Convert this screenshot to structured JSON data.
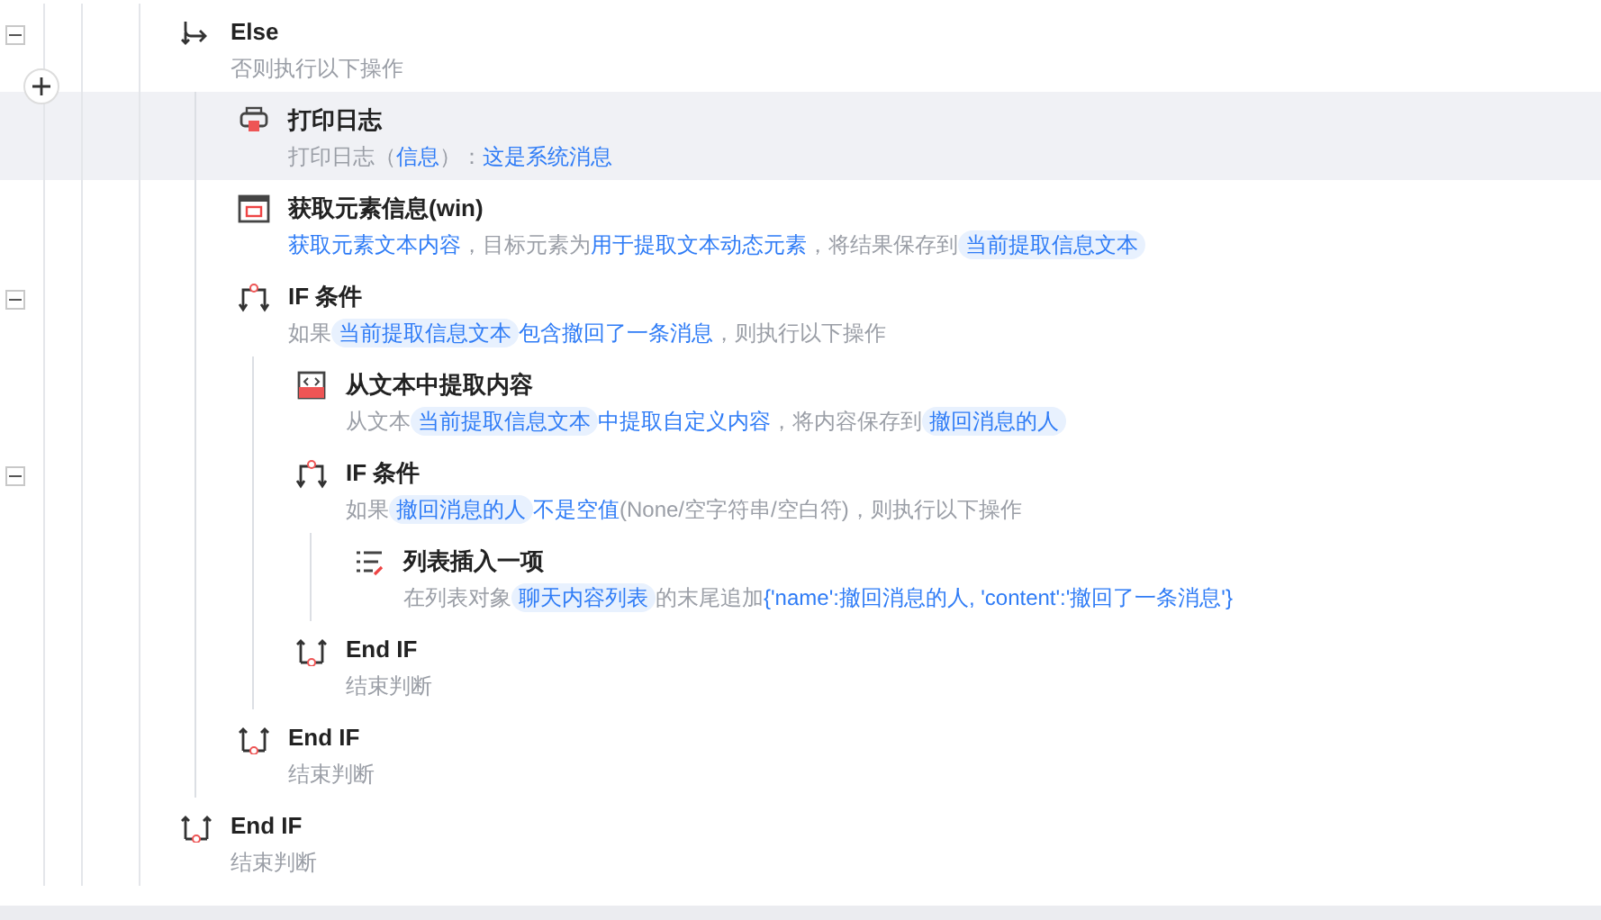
{
  "steps": [
    {
      "kind": "else",
      "title": "Else",
      "expanded": true,
      "selected": false,
      "desc": [
        {
          "kind": "text",
          "text": "否则执行以下操作"
        }
      ],
      "children": [
        {
          "kind": "print",
          "title": "打印日志",
          "selected": true,
          "desc": [
            {
              "kind": "text",
              "text": "打印日志（"
            },
            {
              "kind": "link",
              "text": "信息"
            },
            {
              "kind": "text",
              "text": "）："
            },
            {
              "kind": "link",
              "text": "这是系统消息"
            }
          ]
        },
        {
          "kind": "element",
          "title": "获取元素信息(win)",
          "selected": false,
          "desc": [
            {
              "kind": "link",
              "text": "获取元素文本内容"
            },
            {
              "kind": "text",
              "text": "，目标元素为"
            },
            {
              "kind": "link",
              "text": "用于提取文本动态元素"
            },
            {
              "kind": "text",
              "text": "，将结果保存到"
            },
            {
              "kind": "tag",
              "text": "当前提取信息文本"
            }
          ]
        },
        {
          "kind": "if",
          "title": "IF 条件",
          "expanded": true,
          "selected": false,
          "desc": [
            {
              "kind": "text",
              "text": "如果"
            },
            {
              "kind": "tag",
              "text": "当前提取信息文本"
            },
            {
              "kind": "link",
              "text": "包含撤回了一条消息"
            },
            {
              "kind": "text",
              "text": "，则执行以下操作"
            }
          ],
          "children": [
            {
              "kind": "extract",
              "title": "从文本中提取内容",
              "selected": false,
              "desc": [
                {
                  "kind": "text",
                  "text": "从文本"
                },
                {
                  "kind": "tag",
                  "text": "当前提取信息文本"
                },
                {
                  "kind": "link",
                  "text": "中提取自定义内容"
                },
                {
                  "kind": "text",
                  "text": "，将内容保存到"
                },
                {
                  "kind": "tag",
                  "text": "撤回消息的人"
                }
              ]
            },
            {
              "kind": "if",
              "title": "IF 条件",
              "expanded": true,
              "selected": false,
              "desc": [
                {
                  "kind": "text",
                  "text": "如果"
                },
                {
                  "kind": "tag",
                  "text": "撤回消息的人"
                },
                {
                  "kind": "link",
                  "text": "不是空值"
                },
                {
                  "kind": "text",
                  "text": "(None/空字符串/空白符)，则执行以下操作"
                }
              ],
              "children": [
                {
                  "kind": "list-insert",
                  "title": "列表插入一项",
                  "selected": false,
                  "desc": [
                    {
                      "kind": "text",
                      "text": "在列表对象"
                    },
                    {
                      "kind": "tag",
                      "text": "聊天内容列表"
                    },
                    {
                      "kind": "text",
                      "text": "的末尾追加"
                    },
                    {
                      "kind": "link",
                      "text": "{'name':撤回消息的人, 'content':'撤回了一条消息'}"
                    }
                  ]
                }
              ]
            },
            {
              "kind": "end-if",
              "title": "End IF",
              "selected": false,
              "desc": [
                {
                  "kind": "text",
                  "text": "结束判断"
                }
              ]
            }
          ]
        },
        {
          "kind": "end-if",
          "title": "End IF",
          "selected": false,
          "desc": [
            {
              "kind": "text",
              "text": "结束判断"
            }
          ]
        }
      ]
    },
    {
      "kind": "end-if",
      "title": "End IF",
      "selected": false,
      "desc": [
        {
          "kind": "text",
          "text": "结束判断"
        }
      ]
    }
  ]
}
